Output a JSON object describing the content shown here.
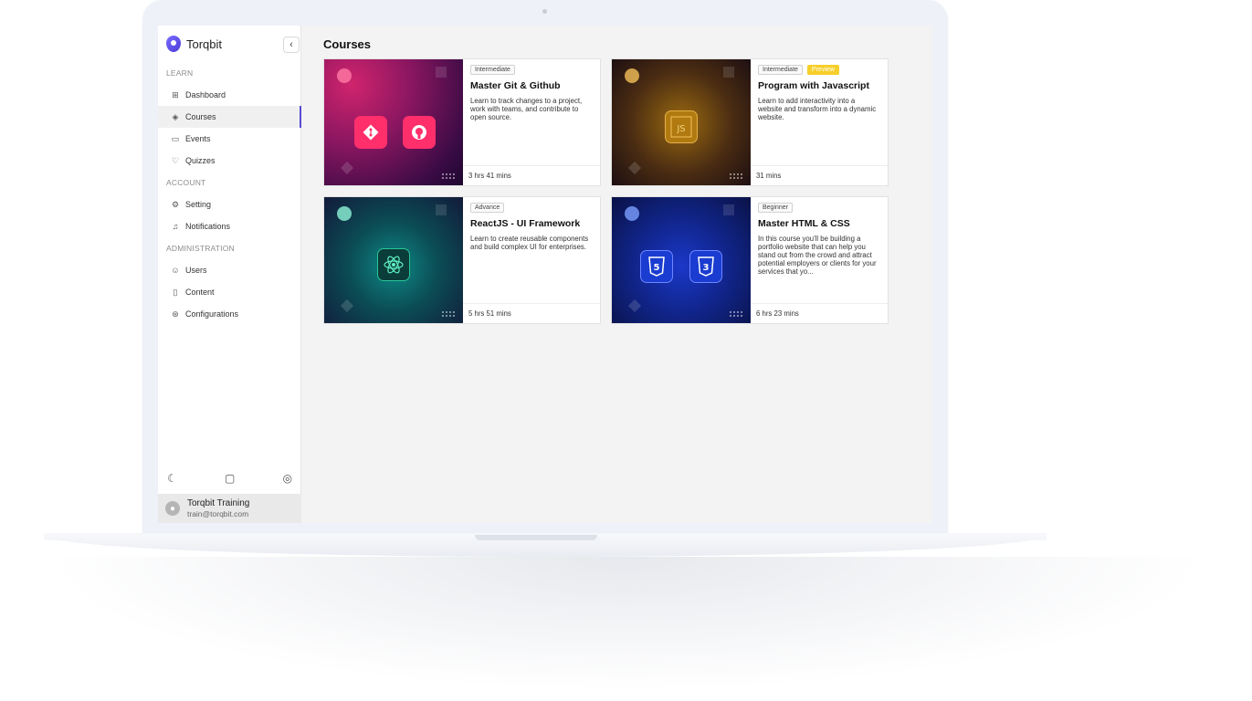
{
  "brand": {
    "name": "Torqbit"
  },
  "sidebar": {
    "sections": [
      {
        "label": "LEARN"
      },
      {
        "label": "ACCOUNT"
      },
      {
        "label": "ADMINISTRATION"
      }
    ],
    "learn_items": [
      {
        "label": "Dashboard",
        "icon": "dashboard-icon"
      },
      {
        "label": "Courses",
        "icon": "graduation-cap-icon",
        "active": true
      },
      {
        "label": "Events",
        "icon": "calendar-icon"
      },
      {
        "label": "Quizzes",
        "icon": "lightbulb-icon"
      }
    ],
    "account_items": [
      {
        "label": "Setting",
        "icon": "gear-icon"
      },
      {
        "label": "Notifications",
        "icon": "bell-icon"
      }
    ],
    "admin_items": [
      {
        "label": "Users",
        "icon": "users-icon"
      },
      {
        "label": "Content",
        "icon": "document-icon"
      },
      {
        "label": "Configurations",
        "icon": "config-icon"
      }
    ],
    "footer_icons": [
      "moon-icon",
      "chat-icon",
      "discord-icon"
    ],
    "user": {
      "name": "Torqbit Training",
      "email": "train@torqbit.com"
    },
    "accent": "#5b4bd6"
  },
  "main": {
    "title": "Courses",
    "courses": [
      {
        "tags": [
          "Intermediate"
        ],
        "title": "Master Git & Github",
        "description": "Learn to track changes to a project, work with teams, and contribute to open source.",
        "duration": "3 hrs 41 mins",
        "theme": "git"
      },
      {
        "tags": [
          "Intermediate",
          "Preview"
        ],
        "title": "Program with Javascript",
        "description": "Learn to add interactivity into a website and transform into a dynamic website.",
        "duration": "31 mins",
        "theme": "js"
      },
      {
        "tags": [
          "Advance"
        ],
        "title": "ReactJS - UI Framework",
        "description": "Learn to create reusable components and build complex UI for enterprises.",
        "duration": "5 hrs 51 mins",
        "theme": "react"
      },
      {
        "tags": [
          "Beginner"
        ],
        "title": "Master HTML & CSS",
        "description": "In this course you'll be building a portfolio website that can help you stand out from the crowd and attract potential employers or clients for your services that yo...",
        "duration": "6 hrs 23 mins",
        "theme": "html"
      }
    ]
  },
  "preview_color": "#f6cf2a"
}
